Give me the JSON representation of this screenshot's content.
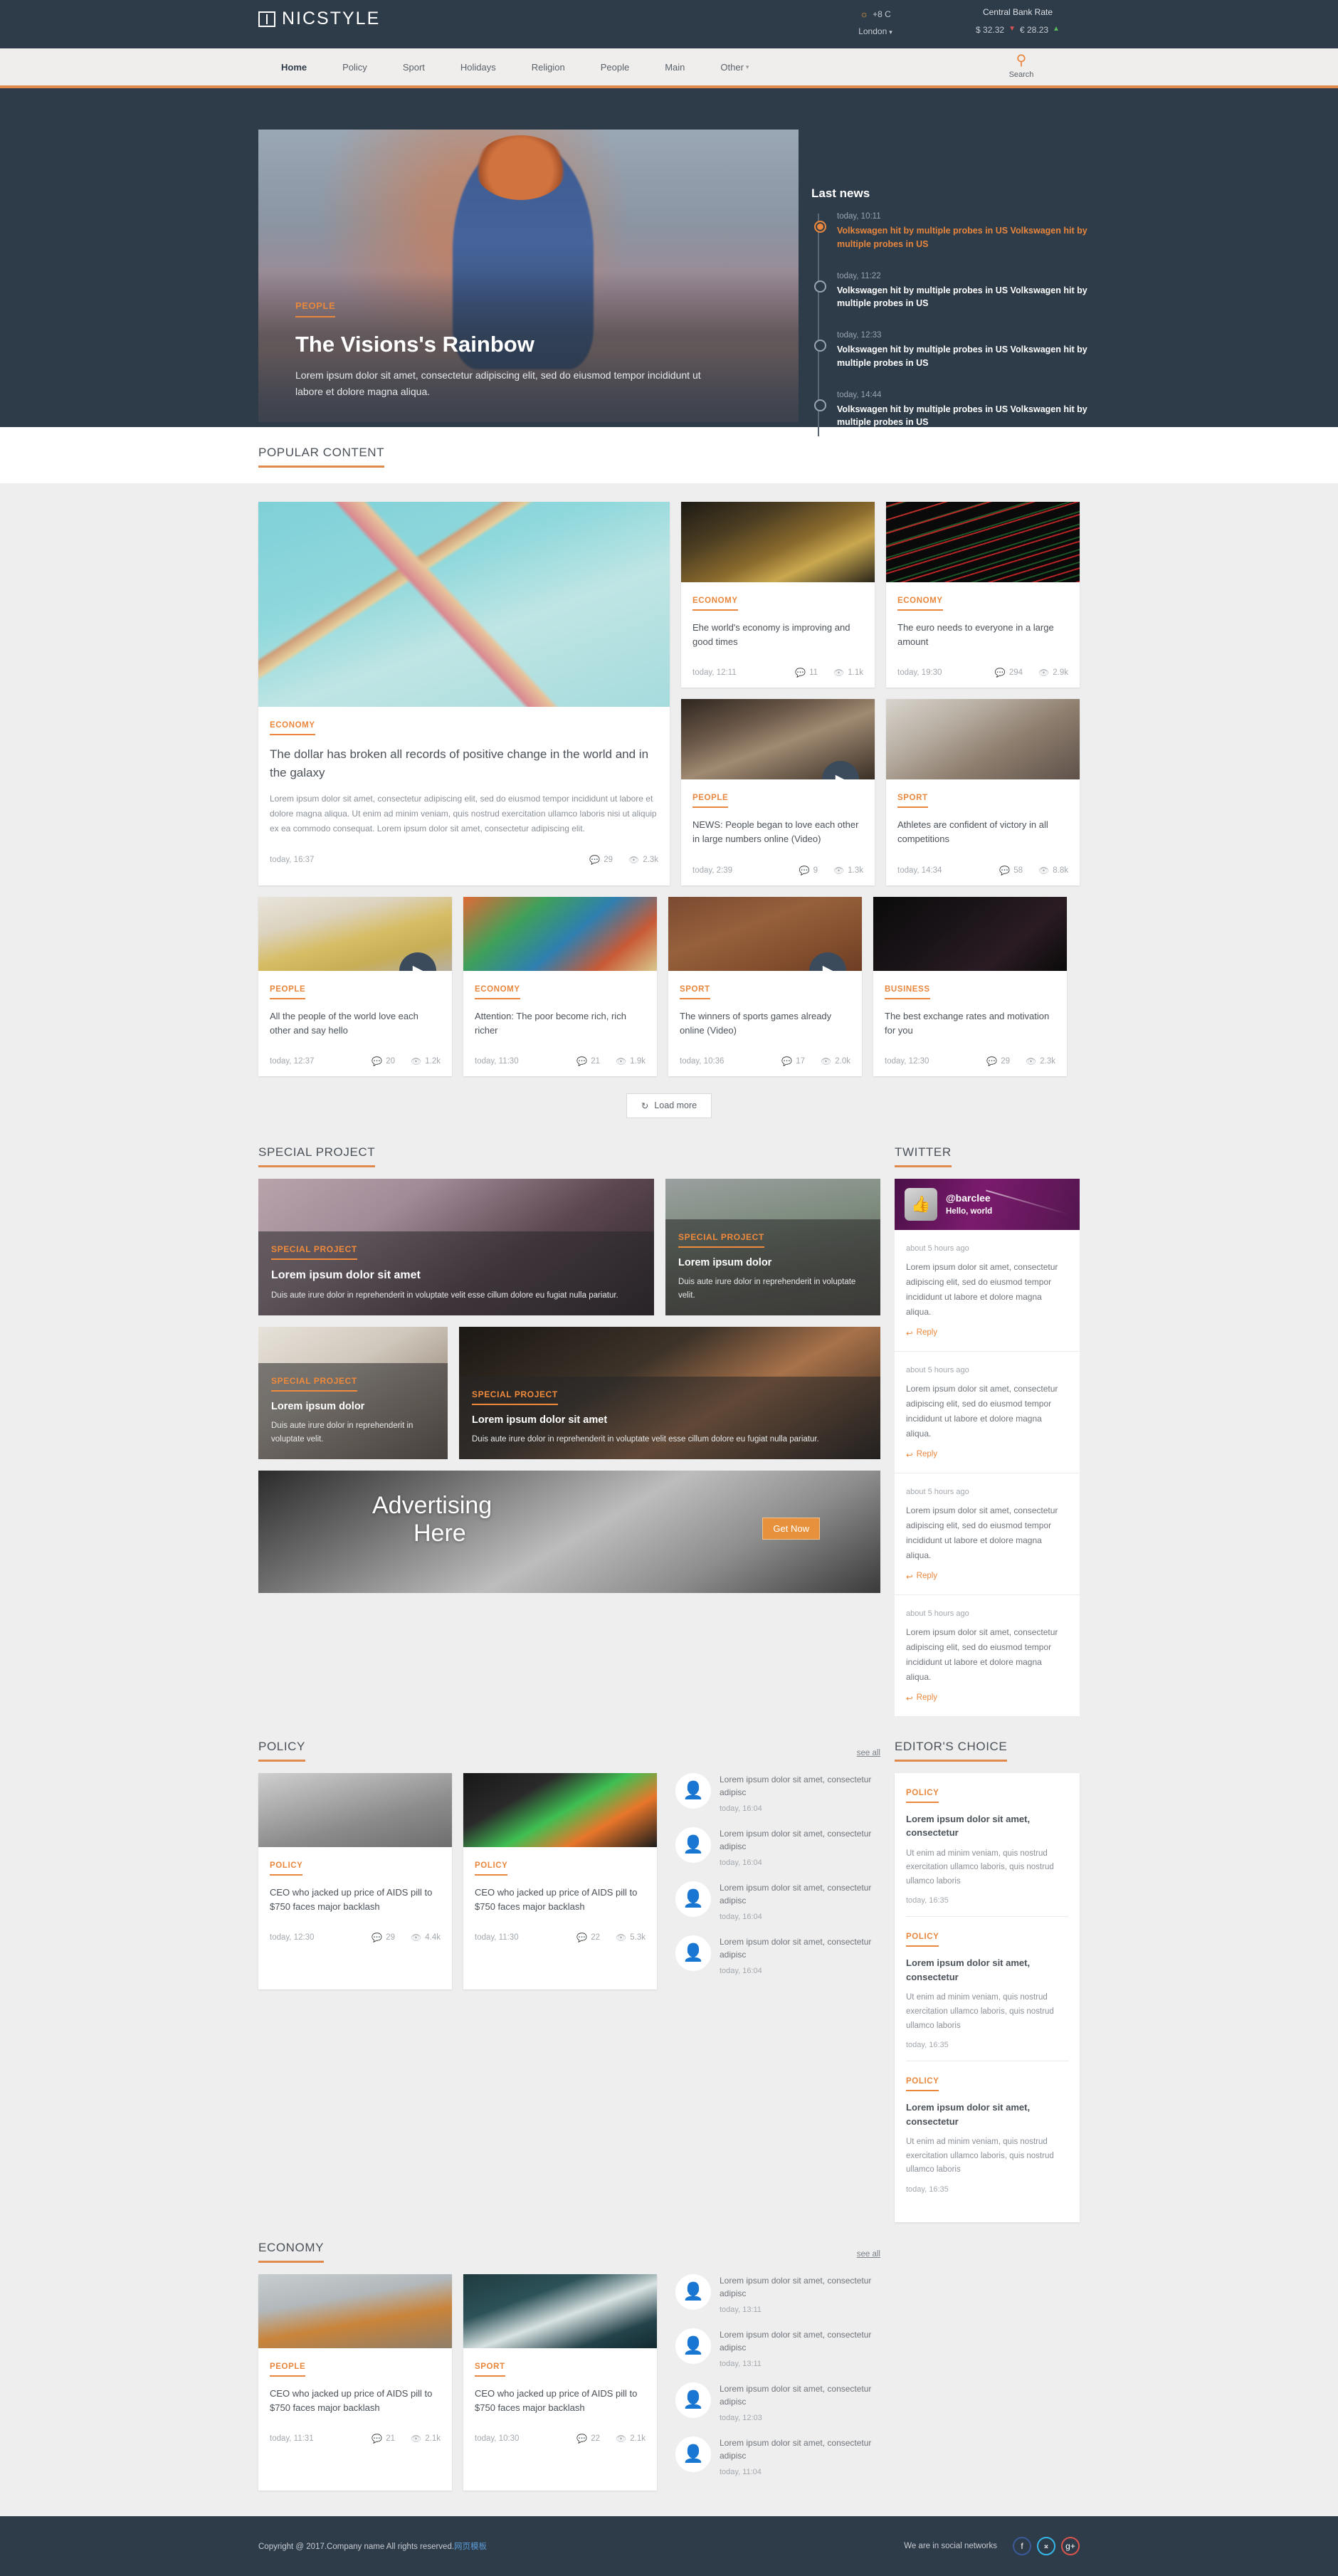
{
  "brand": {
    "name": "NICSTYLE",
    "logo_icon": "book-icon"
  },
  "topbar": {
    "weather": {
      "icon": "sun-icon",
      "temp": "+8 C",
      "city": "London",
      "caret": "⌄"
    },
    "rate": {
      "title": "Central Bank Rate",
      "usd": "$ 32.32",
      "usd_dir": "▼",
      "eur": "€ 28.23",
      "eur_dir": "▲"
    }
  },
  "nav": {
    "items": [
      {
        "label": "Home",
        "active": true
      },
      {
        "label": "Policy"
      },
      {
        "label": "Sport"
      },
      {
        "label": "Holidays"
      },
      {
        "label": "Religion"
      },
      {
        "label": "People"
      },
      {
        "label": "Main"
      },
      {
        "label": "Other",
        "caret": "▾"
      }
    ],
    "search": {
      "icon": "search-icon",
      "label": "Search"
    }
  },
  "hero": {
    "category": "PEOPLE",
    "title": "The Visions's Rainbow",
    "description": "Lorem ipsum dolor sit amet, consectetur adipiscing elit, sed do eiusmod tempor incididunt ut labore et dolore magna aliqua."
  },
  "last_news": {
    "heading": "Last news",
    "items": [
      {
        "time": "today, 10:11",
        "text": "Volkswagen hit by multiple probes in US Volkswagen hit by multiple probes in US",
        "active": true
      },
      {
        "time": "today, 11:22",
        "text": "Volkswagen hit by multiple probes in US Volkswagen hit by multiple probes in US"
      },
      {
        "time": "today, 12:33",
        "text": "Volkswagen hit by multiple probes in US Volkswagen hit by multiple probes in US"
      },
      {
        "time": "today, 14:44",
        "text": "Volkswagen hit by multiple probes in US Volkswagen hit by multiple probes in US"
      }
    ]
  },
  "popular": {
    "heading": "POPULAR CONTENT",
    "feature": {
      "category": "ECONOMY",
      "title": "The dollar has broken all records of positive change in the world and in the galaxy",
      "text": "Lorem ipsum dolor sit amet, consectetur adipiscing elit, sed do eiusmod tempor incididunt ut labore et dolore magna aliqua. Ut enim ad minim veniam, quis nostrud exercitation ullamco laboris nisi ut aliquip ex ea commodo consequat. Lorem ipsum dolor sit amet, consectetur adipiscing elit.",
      "time": "today, 16:37",
      "comments": "29",
      "views": "2.3k"
    },
    "cards": [
      {
        "category": "ECONOMY",
        "title": "Ehe world's economy is improving and good times",
        "time": "today, 12:11",
        "comments": "11",
        "views": "1.1k",
        "video": false
      },
      {
        "category": "ECONOMY",
        "title": "The euro needs to everyone in a large amount",
        "time": "today, 19:30",
        "comments": "294",
        "views": "2.9k",
        "video": false
      },
      {
        "category": "PEOPLE",
        "title": "NEWS: People began to love each other in large numbers online (Video)",
        "time": "today, 2:39",
        "comments": "9",
        "views": "1.3k",
        "video": true
      },
      {
        "category": "SPORT",
        "title": "Athletes are confident of victory in all competitions",
        "time": "today, 14:34",
        "comments": "58",
        "views": "8.8k",
        "video": false
      },
      {
        "category": "PEOPLE",
        "title": "All the people of the world love each other and say hello",
        "time": "today, 12:37",
        "comments": "20",
        "views": "1.2k",
        "video": true
      },
      {
        "category": "ECONOMY",
        "title": "Attention: The poor become rich, rich richer",
        "time": "today, 11:30",
        "comments": "21",
        "views": "1.9k",
        "video": false
      },
      {
        "category": "SPORT",
        "title": "The winners of sports games already online (Video)",
        "time": "today, 10:36",
        "comments": "17",
        "views": "2.0k",
        "video": true
      },
      {
        "category": "BUSINESS",
        "title": "The best exchange rates and motivation for you",
        "time": "today, 12:30",
        "comments": "29",
        "views": "2.3k",
        "video": false
      }
    ],
    "load_more": {
      "label": "Load more",
      "icon": "refresh-icon"
    }
  },
  "special_project": {
    "heading": "SPECIAL PROJECT",
    "items": [
      {
        "category": "SPECIAL PROJECT",
        "title": "Lorem ipsum dolor sit amet",
        "text": "Duis aute irure dolor in reprehenderit in voluptate velit esse cillum dolore eu fugiat nulla pariatur."
      },
      {
        "category": "SPECIAL PROJECT",
        "title": "Lorem ipsum dolor",
        "text": "Duis aute irure dolor in reprehenderit in voluptate velit."
      },
      {
        "category": "SPECIAL PROJECT",
        "title": "Lorem ipsum dolor",
        "text": "Duis aute irure dolor in reprehenderit in voluptate velit."
      },
      {
        "category": "SPECIAL PROJECT",
        "title": "Lorem ipsum dolor sit amet",
        "text": "Duis aute irure dolor in reprehenderit in voluptate velit esse cillum dolore eu fugiat nulla pariatur."
      }
    ]
  },
  "advertising": {
    "line1": "Advertising",
    "line2": "Here",
    "button": "Get Now"
  },
  "twitter": {
    "heading": "TWITTER",
    "account": {
      "handle": "@barclee",
      "status": "Hello, world",
      "avatar_icon": "thumbs-up-icon"
    },
    "tweets": [
      {
        "ago": "about 5 hours ago",
        "text": "Lorem ipsum dolor sit amet, consectetur adipiscing elit, sed do eiusmod tempor incididunt ut labore et dolore magna aliqua.",
        "reply": "Reply"
      },
      {
        "ago": "about 5 hours ago",
        "text": "Lorem ipsum dolor sit amet, consectetur adipiscing elit, sed do eiusmod tempor incididunt ut labore et dolore magna aliqua.",
        "reply": "Reply"
      },
      {
        "ago": "about 5 hours ago",
        "text": "Lorem ipsum dolor sit amet, consectetur adipiscing elit, sed do eiusmod tempor incididunt ut labore et dolore magna aliqua.",
        "reply": "Reply"
      },
      {
        "ago": "about 5 hours ago",
        "text": "Lorem ipsum dolor sit amet, consectetur adipiscing elit, sed do eiusmod tempor incididunt ut labore et dolore magna aliqua.",
        "reply": "Reply"
      }
    ]
  },
  "policy": {
    "heading": "POLICY",
    "see_all": "see all",
    "cards": [
      {
        "category": "POLICY",
        "title": "CEO who jacked up price of AIDS pill to $750 faces major backlash",
        "time": "today, 12:30",
        "comments": "29",
        "views": "4.4k"
      },
      {
        "category": "POLICY",
        "title": "CEO who jacked up price of AIDS pill to $750 faces major backlash",
        "time": "today, 11:30",
        "comments": "22",
        "views": "5.3k"
      }
    ],
    "list": [
      {
        "title": "Lorem ipsum dolor sit amet, consectetur adipisc",
        "time": "today, 16:04"
      },
      {
        "title": "Lorem ipsum dolor sit amet, consectetur adipisc",
        "time": "today, 16:04"
      },
      {
        "title": "Lorem ipsum dolor sit amet, consectetur adipisc",
        "time": "today, 16:04"
      },
      {
        "title": "Lorem ipsum dolor sit amet, consectetur adipisc",
        "time": "today, 16:04"
      }
    ]
  },
  "economy": {
    "heading": "ECONOMY",
    "see_all": "see all",
    "cards": [
      {
        "category": "PEOPLE",
        "title": "CEO who jacked up price of AIDS pill to $750 faces major backlash",
        "time": "today, 11:31",
        "comments": "21",
        "views": "2.1k"
      },
      {
        "category": "SPORT",
        "title": "CEO who jacked up price of AIDS pill to $750 faces major backlash",
        "time": "today, 10:30",
        "comments": "22",
        "views": "2.1k"
      }
    ],
    "list": [
      {
        "title": "Lorem ipsum dolor sit amet, consectetur adipisc",
        "time": "today, 13:11"
      },
      {
        "title": "Lorem ipsum dolor sit amet, consectetur adipisc",
        "time": "today, 13:11"
      },
      {
        "title": "Lorem ipsum dolor sit amet, consectetur adipisc",
        "time": "today, 12:03"
      },
      {
        "title": "Lorem ipsum dolor sit amet, consectetur adipisc",
        "time": "today, 11:04"
      }
    ]
  },
  "editors_choice": {
    "heading": "EDITOR'S CHOICE",
    "items": [
      {
        "category": "POLICY",
        "title": "Lorem ipsum dolor sit amet, consectetur",
        "text": "Ut enim ad minim veniam, quis nostrud exercitation ullamco laboris, quis nostrud ullamco laboris",
        "time": "today, 16:35"
      },
      {
        "category": "POLICY",
        "title": "Lorem ipsum dolor sit amet, consectetur",
        "text": "Ut enim ad minim veniam, quis nostrud exercitation ullamco laboris, quis nostrud ullamco laboris",
        "time": "today, 16:35"
      },
      {
        "category": "POLICY",
        "title": "Lorem ipsum dolor sit amet, consectetur",
        "text": "Ut enim ad minim veniam, quis nostrud exercitation ullamco laboris, quis nostrud ullamco laboris",
        "time": "today, 16:35"
      }
    ]
  },
  "footer": {
    "copyright": "Copyright @ 2017.Company name All rights reserved.",
    "credit_link": "网页模板",
    "social_text": "We are in social networks",
    "social": [
      {
        "name": "facebook",
        "glyph": "f"
      },
      {
        "name": "twitter",
        "glyph": "ᵛ"
      },
      {
        "name": "google-plus",
        "glyph": "g+"
      }
    ]
  },
  "icons": {
    "comment": "○",
    "eye": "◉",
    "play": "▶",
    "refresh": "↻",
    "reply": "↩",
    "search": "⚲",
    "sun": "☀",
    "thumb": "☝"
  }
}
